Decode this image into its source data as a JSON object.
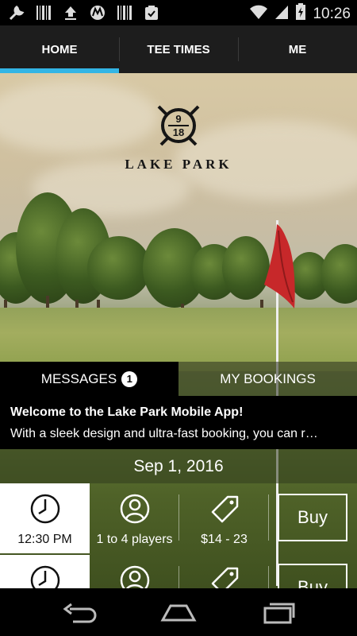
{
  "status_bar": {
    "time": "10:26",
    "left_icons": [
      "wrench-icon",
      "barcode-icon",
      "upload-icon",
      "motorola-icon",
      "barcode-icon",
      "clipboard-check-icon"
    ],
    "right_icons": [
      "wifi-icon",
      "signal-icon",
      "battery-charging-icon"
    ]
  },
  "tabs": [
    {
      "label": "HOME",
      "active": true
    },
    {
      "label": "TEE TIMES",
      "active": false
    },
    {
      "label": "ME",
      "active": false
    }
  ],
  "logo": {
    "number_top": "9",
    "number_bottom": "18",
    "name": "LAKE PARK"
  },
  "messages_panel": {
    "messages_tab": "MESSAGES",
    "messages_count": "1",
    "bookings_tab": "MY BOOKINGS",
    "message_title": "Welcome to the Lake Park Mobile App!",
    "message_text": "With a sleek design and ultra-fast booking, you can r…"
  },
  "date": "Sep 1, 2016",
  "tee_times": [
    {
      "time": "12:30 PM",
      "players": "1 to 4 players",
      "price": "$14 - 23",
      "buy_label": "Buy"
    },
    {
      "time": "",
      "players": "",
      "price": "",
      "buy_label": "Buy"
    }
  ],
  "colors": {
    "accent": "#33b5e5",
    "tab_bar": "#1d1d1d",
    "flag": "#c7282a"
  },
  "nav_icons": [
    "back-icon",
    "home-icon",
    "recents-icon"
  ]
}
